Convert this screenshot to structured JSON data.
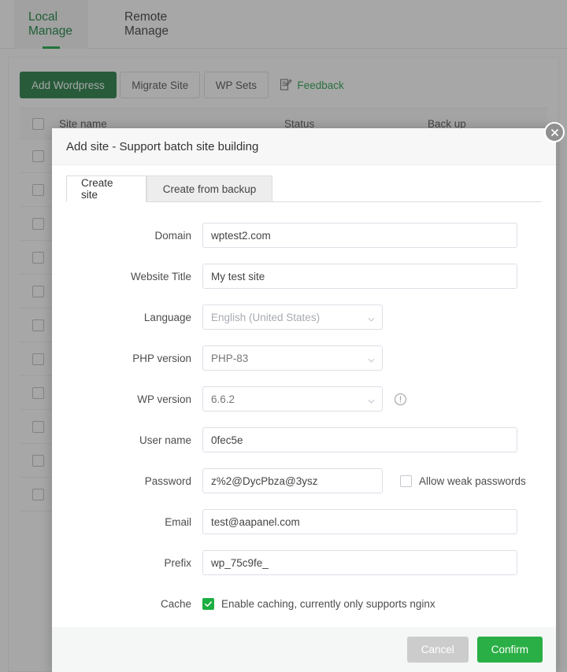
{
  "top_tabs": [
    {
      "label": "Local Manage",
      "active": true
    },
    {
      "label": "Remote Manage",
      "active": false
    }
  ],
  "toolbar": {
    "add_wordpress": "Add Wordpress",
    "migrate_site": "Migrate Site",
    "wp_sets": "WP Sets",
    "feedback": "Feedback",
    "feedback_icon": "document-edit-icon"
  },
  "table": {
    "columns": [
      "Site name",
      "Status",
      "Back up"
    ],
    "row_count": 11
  },
  "modal": {
    "title": "Add site - Support batch site building",
    "close_icon": "close-icon",
    "tabs": [
      {
        "label": "Create site",
        "active": true
      },
      {
        "label": "Create from backup",
        "active": false
      }
    ],
    "fields": {
      "domain": {
        "label": "Domain",
        "value": "wptest2.com"
      },
      "website_title": {
        "label": "Website Title",
        "value": "My test site"
      },
      "language": {
        "label": "Language",
        "value": "English (United States)",
        "icon": "chevron-down-icon"
      },
      "php_version": {
        "label": "PHP version",
        "value": "PHP-83",
        "icon": "chevron-down-icon"
      },
      "wp_version": {
        "label": "WP version",
        "value": "6.6.2",
        "icon": "chevron-down-icon",
        "warning_icon": "info-circle-icon"
      },
      "user_name": {
        "label": "User name",
        "value": "0fec5e"
      },
      "password": {
        "label": "Password",
        "value": "z%2@DycPbza@3ysz"
      },
      "allow_weak": {
        "label": "Allow weak passwords",
        "checked": false
      },
      "email": {
        "label": "Email",
        "value": "test@aapanel.com"
      },
      "prefix": {
        "label": "Prefix",
        "value": "wp_75c9fe_"
      },
      "cache": {
        "label": "Cache",
        "option_label": "Enable caching, currently only supports nginx",
        "checked": true
      }
    },
    "footer": {
      "cancel": "Cancel",
      "confirm": "Confirm"
    }
  },
  "colors": {
    "brand_green": "#17753a",
    "accent_green": "#2aaf46",
    "tab_green": "#13a33b",
    "checkbox_green": "#1cae42"
  }
}
